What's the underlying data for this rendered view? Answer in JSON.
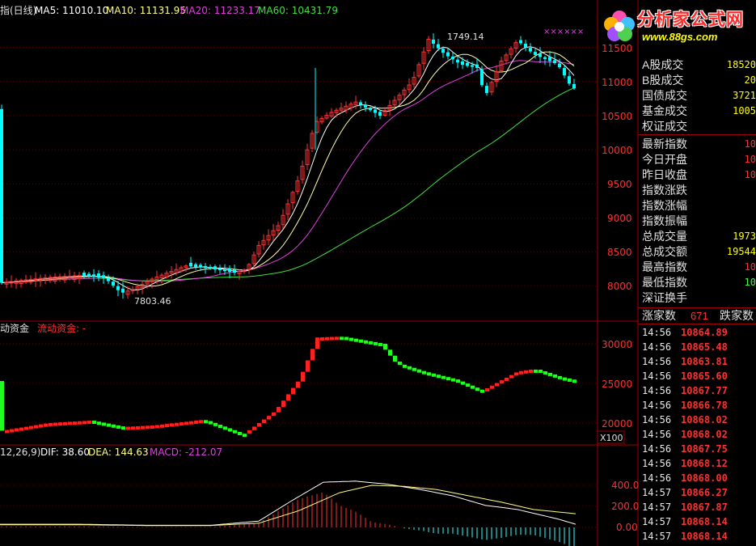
{
  "header": {
    "title": "指(日线)",
    "ma5": "MA5: 11010.10",
    "ma10": "MA10: 11131.95",
    "ma20": "MA20: 11233.17",
    "ma60": "MA60: 10431.79"
  },
  "logo": {
    "name": "分析家公式网",
    "url": "www.88gs.com"
  },
  "price_axis": [
    "11500",
    "11000",
    "10500",
    "10000",
    "9500",
    "9000",
    "8500",
    "8000"
  ],
  "price_annotations": {
    "high": "1749.14",
    "low": "7803.46"
  },
  "high_markers": "××××××",
  "panel2": {
    "title": "动资金",
    "subtitle": "流动资金: -",
    "axis": [
      "30000",
      "25000",
      "20000"
    ],
    "unit": "X100"
  },
  "panel3": {
    "title": "12,26,9)",
    "dif": "DIF: 38.60",
    "dea": "DEA: 144.63",
    "macd": "MACD: -212.07",
    "axis": [
      "400.00",
      "200.00",
      "0.00"
    ]
  },
  "side_panel": {
    "volume_rows": [
      {
        "label": "A股成交",
        "value": "18520"
      },
      {
        "label": "B股成交",
        "value": "20"
      },
      {
        "label": "国债成交",
        "value": "3721"
      },
      {
        "label": "基金成交",
        "value": "1005"
      },
      {
        "label": "权证成交",
        "value": ""
      }
    ],
    "index_rows": [
      {
        "label": "最新指数",
        "value": "10"
      },
      {
        "label": "今日开盘",
        "value": "10"
      },
      {
        "label": "昨日收盘",
        "value": "10"
      },
      {
        "label": "指数涨跌",
        "value": ""
      },
      {
        "label": "指数涨幅",
        "value": ""
      },
      {
        "label": "指数振幅",
        "value": ""
      },
      {
        "label": "总成交量",
        "value": "1973"
      },
      {
        "label": "总成交额",
        "value": "19544"
      },
      {
        "label": "最高指数",
        "value": "10"
      },
      {
        "label": "最低指数",
        "value": "10"
      },
      {
        "label": "深证换手",
        "value": ""
      }
    ],
    "advance_label": "涨家数",
    "advance_count": "671",
    "decline_label": "跌家数",
    "ticks": [
      {
        "time": "14:56",
        "price": "10864.89"
      },
      {
        "time": "14:56",
        "price": "10865.48"
      },
      {
        "time": "14:56",
        "price": "10863.81"
      },
      {
        "time": "14:56",
        "price": "10865.60"
      },
      {
        "time": "14:56",
        "price": "10867.77"
      },
      {
        "time": "14:56",
        "price": "10866.78"
      },
      {
        "time": "14:56",
        "price": "10868.02"
      },
      {
        "time": "14:56",
        "price": "10868.02"
      },
      {
        "time": "14:56",
        "price": "10867.75"
      },
      {
        "time": "14:56",
        "price": "10868.12"
      },
      {
        "time": "14:56",
        "price": "10868.00"
      },
      {
        "time": "14:57",
        "price": "10866.27"
      },
      {
        "time": "14:57",
        "price": "10867.87"
      },
      {
        "time": "14:57",
        "price": "10868.14"
      },
      {
        "time": "14:57",
        "price": "10868.14"
      }
    ]
  },
  "colors": {
    "up": "#ff3232",
    "down": "#00ffff",
    "ma5": "#ffffff",
    "ma10": "#ffffaa",
    "ma20": "#e040e0",
    "ma60": "#40e040",
    "grid": "#a00000",
    "axis_text": "#ff3030"
  }
}
